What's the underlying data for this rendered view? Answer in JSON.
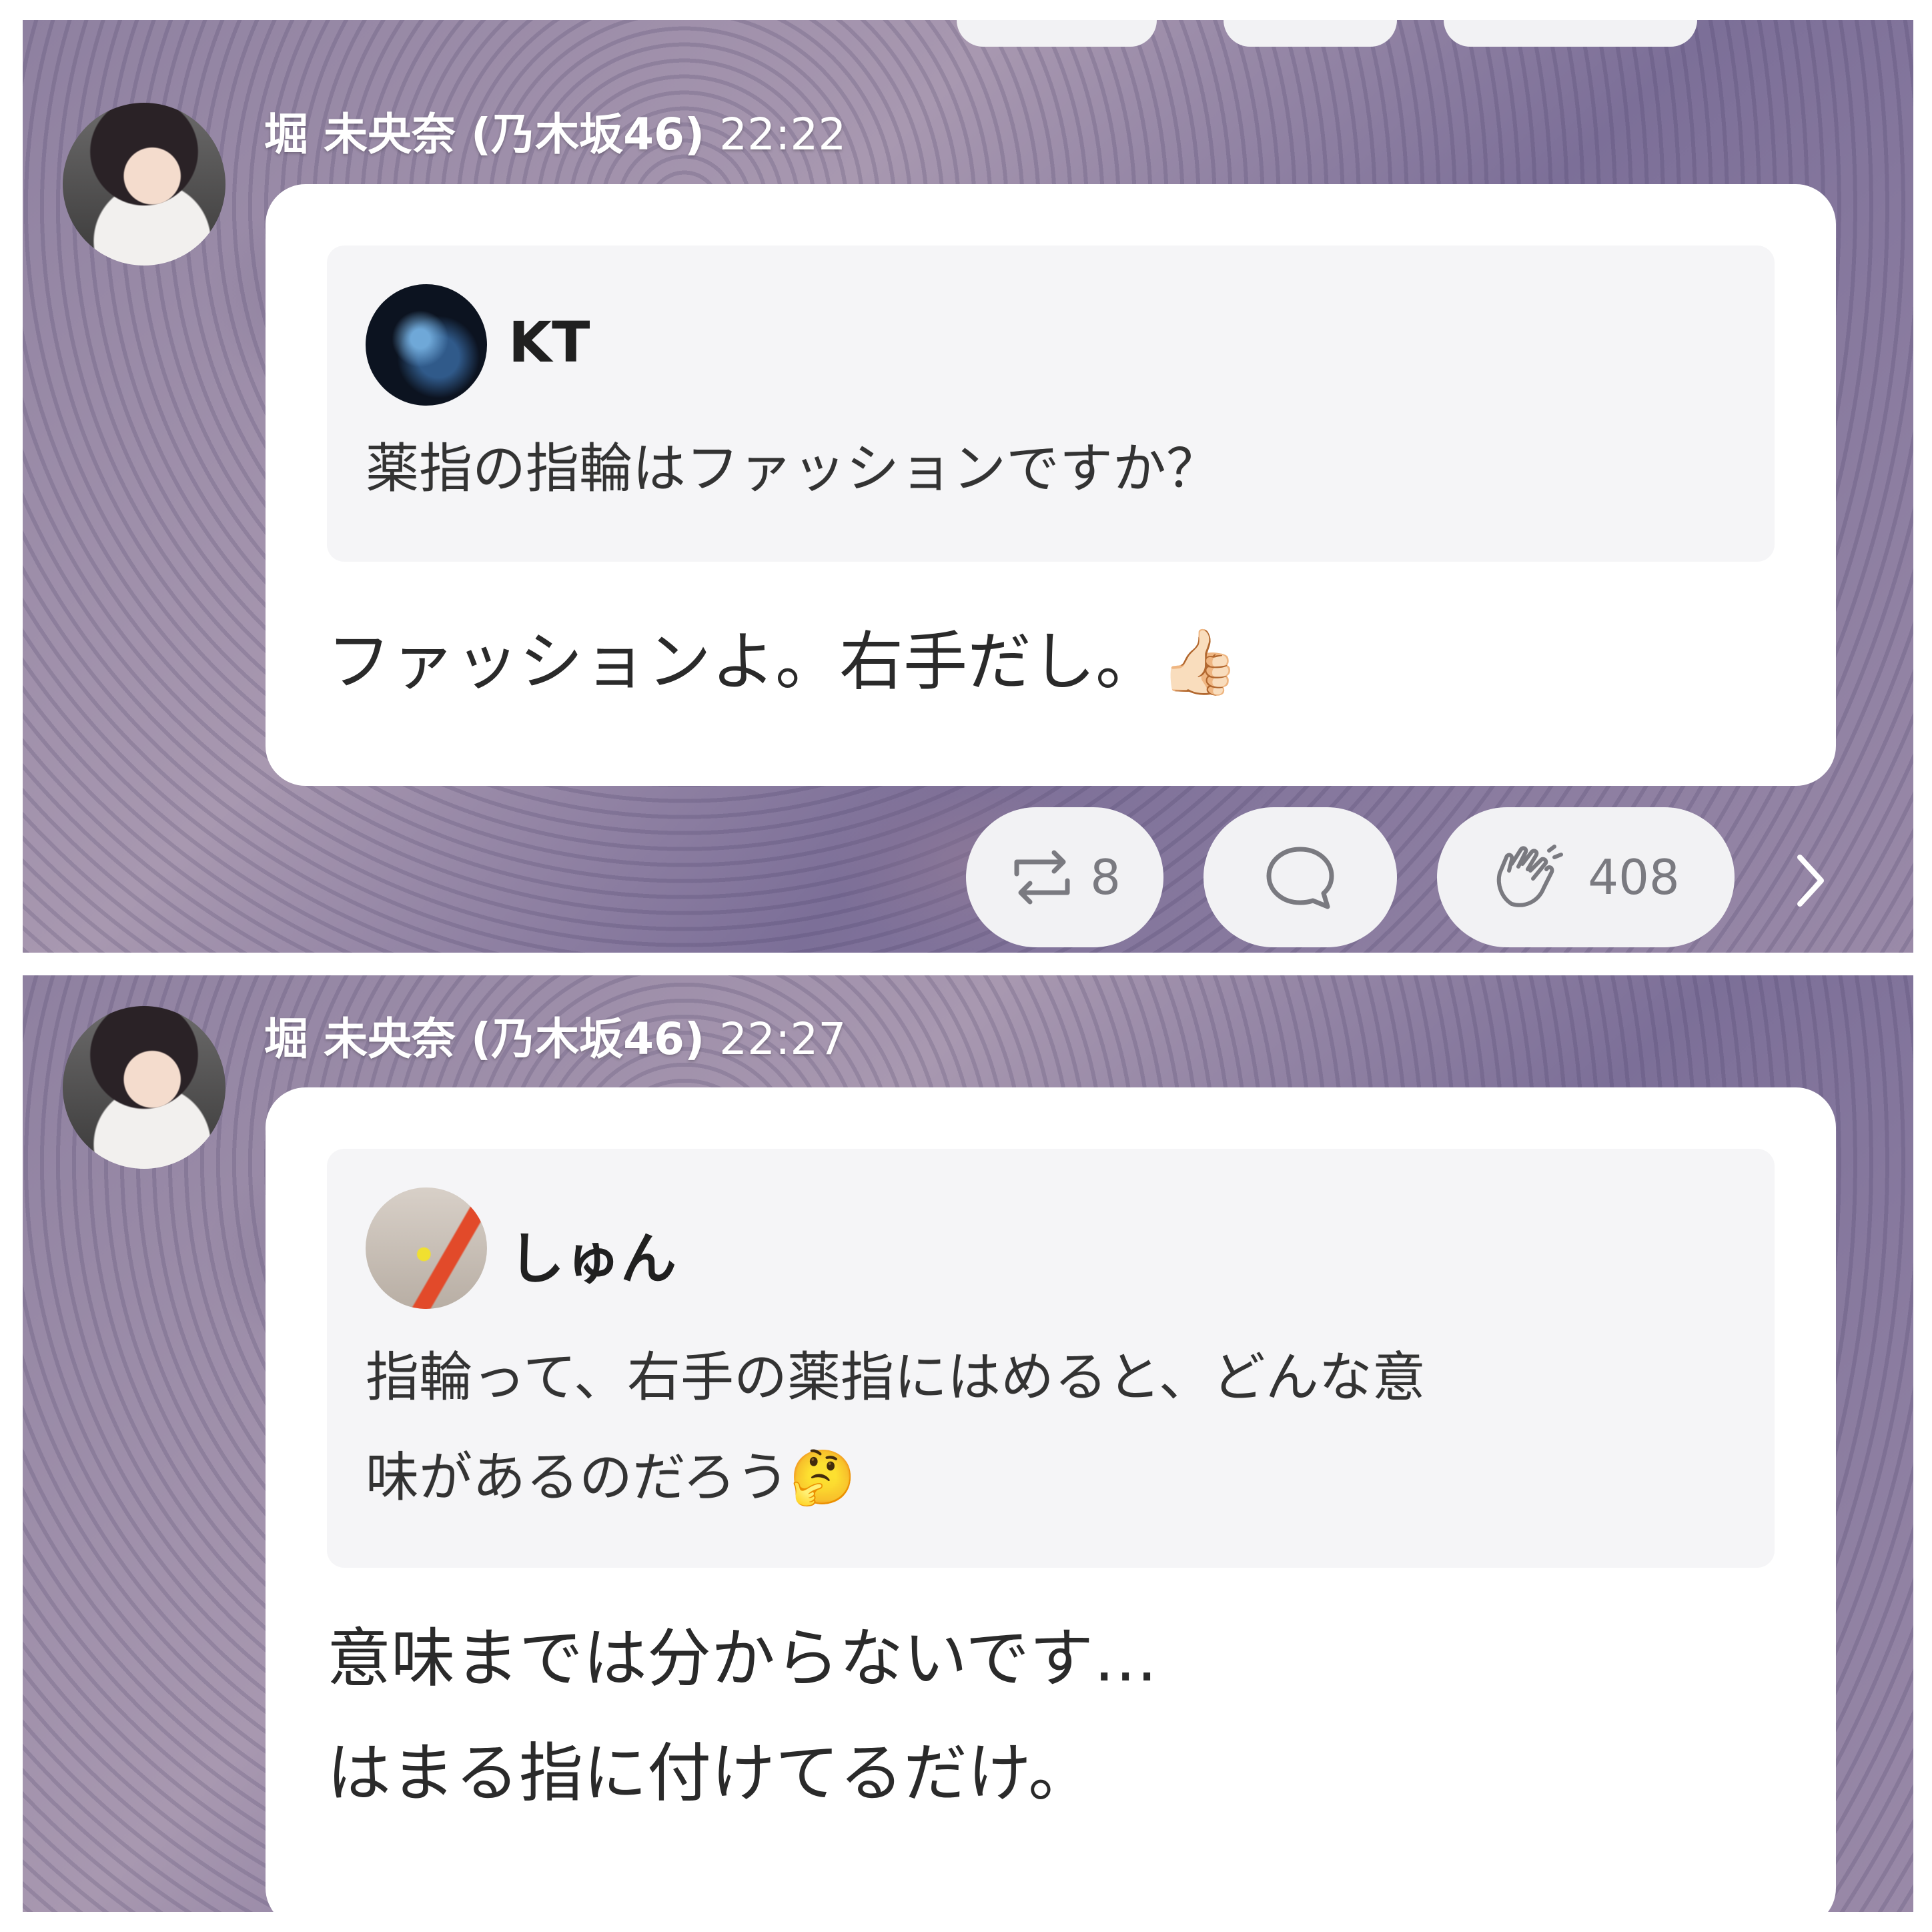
{
  "post1": {
    "sender": "堀 未央奈 (乃木坂46)",
    "time": "22:22",
    "quote": {
      "name": "KT",
      "text": "薬指の指輪はファッションですか？"
    },
    "reply": "ファッションよ。右手だし。👍🏻",
    "actions": {
      "repost_count": "8",
      "clap_count": "408"
    }
  },
  "post2": {
    "sender": "堀 未央奈 (乃木坂46)",
    "time": "22:27",
    "quote": {
      "name": "しゅん",
      "text_line1": "指輪って、右手の薬指にはめると、どんな意",
      "text_line2": "味があるのだろう🤔"
    },
    "reply_line1": "意味までは分からないです…",
    "reply_line2": "はまる指に付けてるだけ。"
  },
  "icons": [
    "avatar",
    "repost-icon",
    "comment-icon",
    "clap-icon",
    "chevron-right-icon"
  ],
  "colors": {
    "bubble": "#ffffff",
    "quote_bg": "#f5f5f7",
    "action_bg": "#f2f2f4",
    "action_fg": "#7a7a80"
  }
}
